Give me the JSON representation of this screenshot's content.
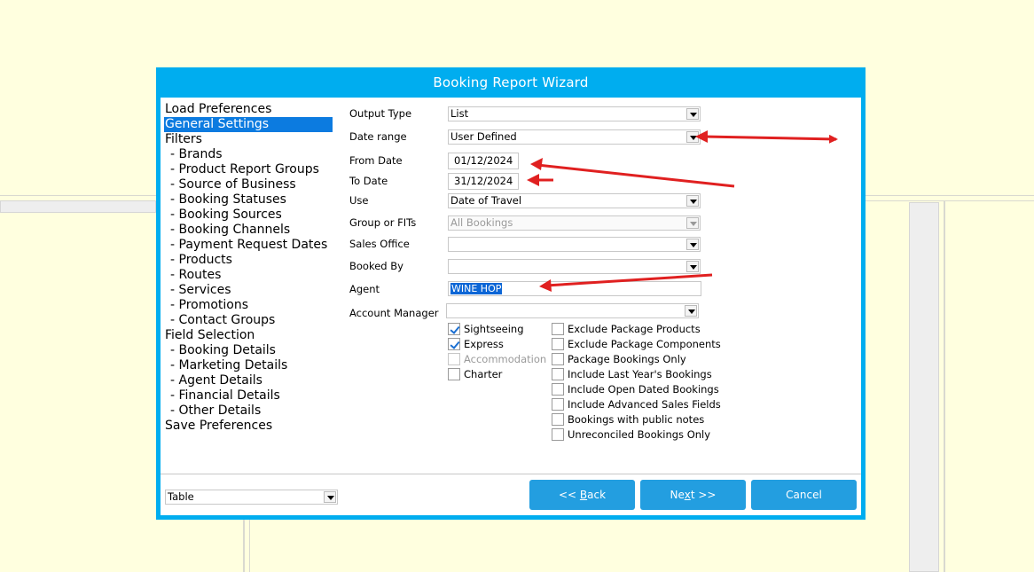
{
  "window": {
    "title": "Booking Report Wizard"
  },
  "nav": {
    "items": [
      {
        "label": "Load Preferences",
        "sub": false,
        "selected": false
      },
      {
        "label": "General Settings",
        "sub": false,
        "selected": true
      },
      {
        "label": "Filters",
        "sub": false,
        "selected": false
      },
      {
        "label": "- Brands",
        "sub": true,
        "selected": false
      },
      {
        "label": "- Product Report Groups",
        "sub": true,
        "selected": false
      },
      {
        "label": "- Source of Business",
        "sub": true,
        "selected": false
      },
      {
        "label": "- Booking Statuses",
        "sub": true,
        "selected": false
      },
      {
        "label": "- Booking Sources",
        "sub": true,
        "selected": false
      },
      {
        "label": "- Booking Channels",
        "sub": true,
        "selected": false
      },
      {
        "label": "- Payment Request Dates",
        "sub": true,
        "selected": false
      },
      {
        "label": "- Products",
        "sub": true,
        "selected": false
      },
      {
        "label": "- Routes",
        "sub": true,
        "selected": false
      },
      {
        "label": "- Services",
        "sub": true,
        "selected": false
      },
      {
        "label": "- Promotions",
        "sub": true,
        "selected": false
      },
      {
        "label": "- Contact Groups",
        "sub": true,
        "selected": false
      },
      {
        "label": "Field Selection",
        "sub": false,
        "selected": false
      },
      {
        "label": "- Booking Details",
        "sub": true,
        "selected": false
      },
      {
        "label": "- Marketing Details",
        "sub": true,
        "selected": false
      },
      {
        "label": "- Agent Details",
        "sub": true,
        "selected": false
      },
      {
        "label": "- Financial Details",
        "sub": true,
        "selected": false
      },
      {
        "label": "- Other Details",
        "sub": true,
        "selected": false
      },
      {
        "label": "Save Preferences",
        "sub": false,
        "selected": false
      }
    ]
  },
  "form": {
    "output_type": {
      "label": "Output Type",
      "value": "List"
    },
    "date_range": {
      "label": "Date range",
      "value": "User Defined"
    },
    "from_date": {
      "label": "From Date",
      "value": "01/12/2024"
    },
    "to_date": {
      "label": "To Date",
      "value": "31/12/2024"
    },
    "use": {
      "label": "Use",
      "value": "Date of Travel"
    },
    "group_or_fits": {
      "label": "Group or FITs",
      "value": "All Bookings",
      "disabled": true
    },
    "sales_office": {
      "label": "Sales Office",
      "value": ""
    },
    "booked_by": {
      "label": "Booked By",
      "value": ""
    },
    "agent": {
      "label": "Agent",
      "value": "WINE HOP"
    },
    "account_manager": {
      "label": "Account Manager",
      "value": ""
    }
  },
  "service_types": [
    {
      "label": "Sightseeing",
      "checked": true,
      "disabled": false
    },
    {
      "label": "Express",
      "checked": true,
      "disabled": false
    },
    {
      "label": "Accommodation",
      "checked": false,
      "disabled": true
    },
    {
      "label": "Charter",
      "checked": false,
      "disabled": false
    }
  ],
  "options": [
    {
      "label": "Exclude Package Products",
      "checked": false
    },
    {
      "label": "Exclude Package Components",
      "checked": false
    },
    {
      "label": "Package Bookings Only",
      "checked": false
    },
    {
      "label": "Include Last Year's Bookings",
      "checked": false
    },
    {
      "label": "Include Open Dated Bookings",
      "checked": false
    },
    {
      "label": "Include Advanced Sales Fields",
      "checked": false
    },
    {
      "label": "Bookings with public notes",
      "checked": false
    },
    {
      "label": "Unreconciled Bookings Only",
      "checked": false
    }
  ],
  "footer": {
    "format": "Table",
    "back_prefix": "<< ",
    "back_accel": "B",
    "back_rest": "ack",
    "next_prefix": "Ne",
    "next_accel": "x",
    "next_rest": "t >>",
    "cancel_label": "Cancel"
  },
  "colors": {
    "dialog_frame": "#00adef",
    "selection": "#0c7be0",
    "button": "#239ee0",
    "annotation_arrow": "#e02020",
    "page_background": "#ffffdf"
  }
}
